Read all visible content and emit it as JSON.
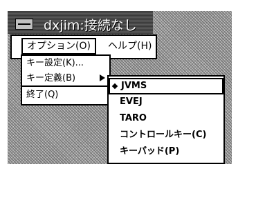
{
  "window": {
    "title": "dxjim:接続なし"
  },
  "menubar": {
    "options_label": "オプション(O)",
    "help_label": "ヘルプ(H)"
  },
  "options_menu": {
    "items": [
      {
        "label": "キー設定(K)..."
      },
      {
        "label": "キー定義(B)"
      },
      {
        "label": "終了(Q)"
      }
    ]
  },
  "key_definition_submenu": {
    "items": [
      {
        "label": "JVMS",
        "selected": true
      },
      {
        "label": "EVEJ",
        "selected": false
      },
      {
        "label": "TARO",
        "selected": false
      },
      {
        "label": "コントロールキー(C)",
        "selected": false
      },
      {
        "label": "キーパッド(P)",
        "selected": false
      }
    ]
  },
  "icons": {
    "window_menu": "window-menu-icon",
    "submenu_arrow": "triangle-right-icon",
    "radio_selected": "diamond-icon"
  }
}
